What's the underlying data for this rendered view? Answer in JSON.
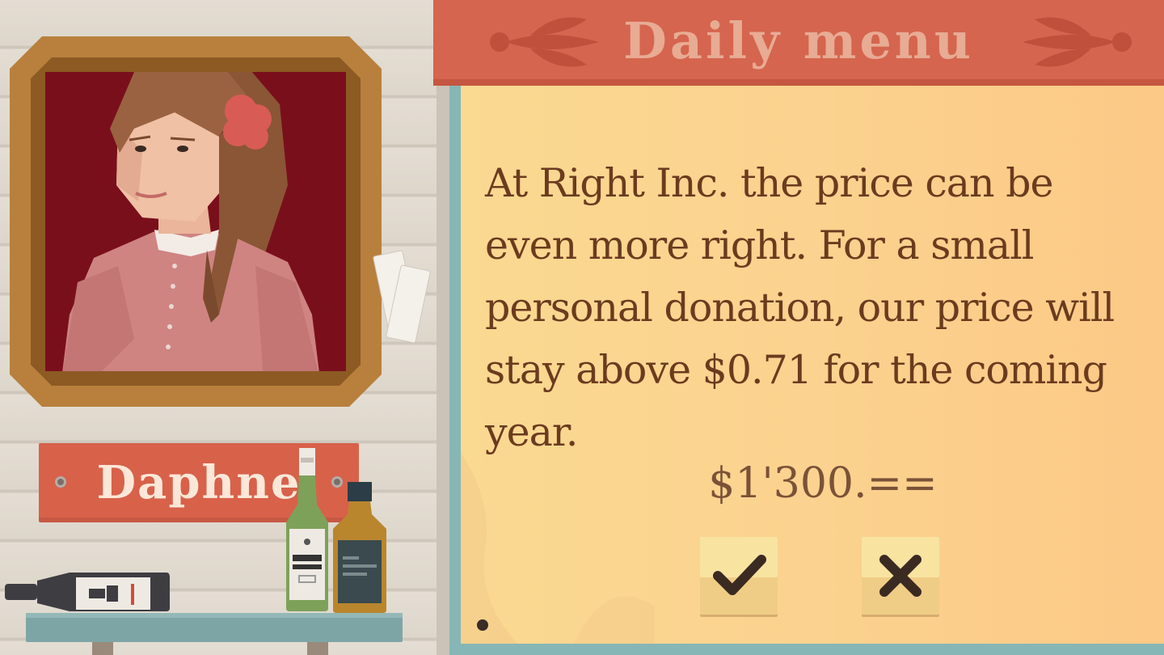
{
  "header": {
    "title": "Daily menu"
  },
  "character": {
    "name": "Daphne"
  },
  "offer": {
    "message": "At Right Inc. the price can be even more right. For a small personal donation, our price will stay above $0.71 for the coming year.",
    "price": "$1'300.=="
  },
  "actions": {
    "accept_icon": "check-icon",
    "decline_icon": "x-icon"
  },
  "colors": {
    "banner": "#d5654e",
    "panel": "#fad991",
    "text": "#6b3b1f",
    "nameplate": "#d8614a",
    "portrait_bg": "#7a0f1c"
  }
}
